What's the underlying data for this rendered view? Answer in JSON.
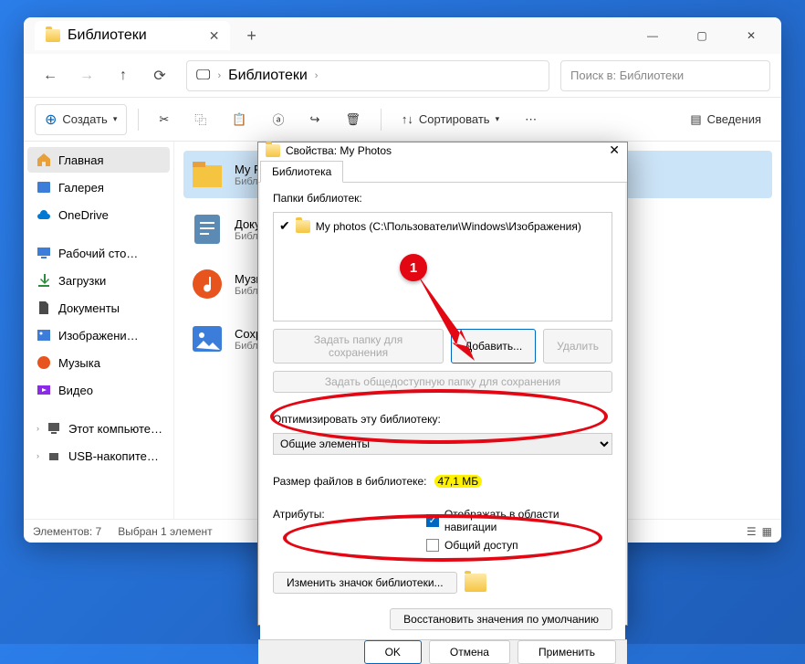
{
  "window": {
    "tab_title": "Библиотеки"
  },
  "nav": {
    "breadcrumb_item": "Библиотеки",
    "search_placeholder": "Поиск в: Библиотеки"
  },
  "toolbar": {
    "create": "Создать",
    "sort": "Сортировать",
    "details": "Сведения"
  },
  "sidebar": {
    "home": "Главная",
    "gallery": "Галерея",
    "onedrive": "OneDrive",
    "desktop": "Рабочий сто…",
    "downloads": "Загрузки",
    "documents": "Документы",
    "images": "Изображени…",
    "music": "Музыка",
    "video": "Видео",
    "this_pc": "Этот компьюте…",
    "usb": "USB-накопите…"
  },
  "items": [
    {
      "name": "My P…",
      "sub": "Библ…"
    },
    {
      "name": "Доку…",
      "sub": "Библ…"
    },
    {
      "name": "Музы…",
      "sub": "Библ…"
    },
    {
      "name": "Сохр…",
      "sub": "Библ…"
    }
  ],
  "statusbar": {
    "count": "Элементов: 7",
    "selected": "Выбран 1 элемент"
  },
  "dialog": {
    "title": "Свойства: My Photos",
    "tab": "Библиотека",
    "folders_label": "Папки библиотек:",
    "folder_entry": "My photos (C:\\Пользователи\\Windows\\Изображения)",
    "btn_set_save": "Задать папку для сохранения",
    "btn_add": "Добавить...",
    "btn_remove": "Удалить",
    "btn_set_public": "Задать общедоступную папку для сохранения",
    "optimize_label": "Оптимизировать эту библиотеку:",
    "optimize_value": "Общие элементы",
    "size_label": "Размер файлов в библиотеке:",
    "size_value": "47,1 МБ",
    "attributes_label": "Атрибуты:",
    "cbx_nav": "Отображать в области навигации",
    "cbx_shared": "Общий доступ",
    "btn_change_icon": "Изменить значок библиотеки...",
    "btn_restore": "Восстановить значения по умолчанию",
    "btn_ok": "OK",
    "btn_cancel": "Отмена",
    "btn_apply": "Применить"
  },
  "annotation": {
    "marker1": "1"
  }
}
